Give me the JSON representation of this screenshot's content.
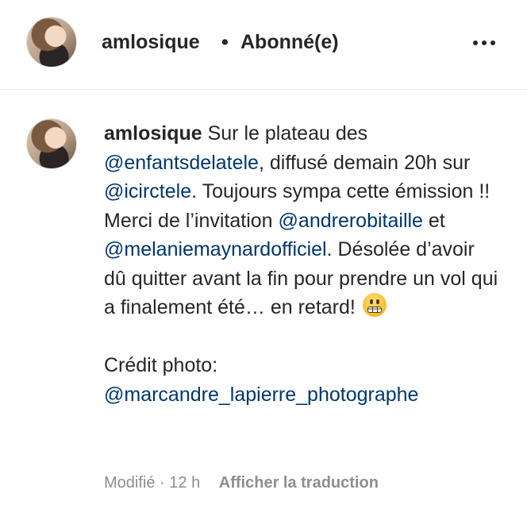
{
  "header": {
    "username": "amlosique",
    "separator": "•",
    "follow_status": "Abonné(e)",
    "more_icon": "more-horizontal-icon"
  },
  "caption": {
    "username": "amlosique",
    "t1": " Sur le plateau des ",
    "m1": "@enfantsdelatele",
    "t2": ", diffusé demain 20h sur ",
    "m2": "@icirctele",
    "t3": ". Toujours sympa cette émission !! Merci de l’invitation ",
    "m3": "@andrerobitaille",
    "t4": " et ",
    "m4": "@melaniemaynardofficiel",
    "t5": ". Désolée d’avoir dû quitter avant la fin pour prendre un vol qui a finalement été… en retard! ",
    "emoji": "grimacing-face-emoji",
    "t6": "Crédit photo:",
    "m5": "@marcandre_lapierre_photographe"
  },
  "meta": {
    "edited": "Modifié",
    "dot": "·",
    "time": "12 h",
    "translate": "Afficher la traduction"
  },
  "colors": {
    "mention": "#00376b",
    "text": "#262626",
    "secondary": "#8e8e8e"
  }
}
